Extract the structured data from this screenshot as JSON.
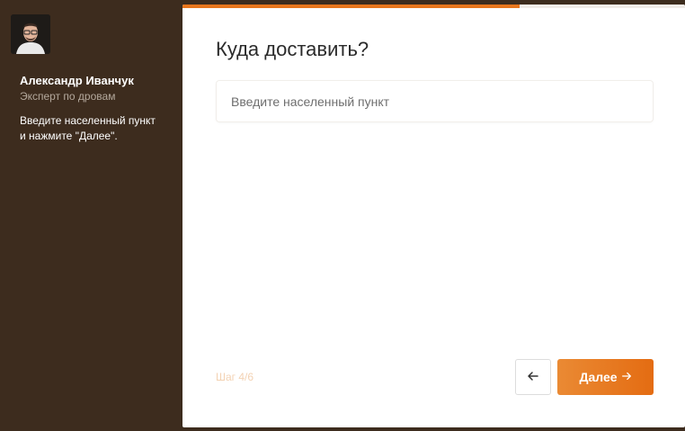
{
  "expert": {
    "name": "Александр Иванчук",
    "role": "Эксперт по дровам",
    "hint_line1": "Введите населенный пункт",
    "hint_line2": "и нажмите \"Далее\"."
  },
  "quiz": {
    "question": "Куда доставить?",
    "input_placeholder": "Введите населенный пункт",
    "input_value": "",
    "step_text": "Шаг 4/6",
    "progress_fraction": 0.67,
    "next_label": "Далее",
    "back_icon": "arrow-left-icon",
    "next_icon": "arrow-right-icon"
  },
  "colors": {
    "sidebar_bg": "#3d2c1e",
    "accent": "#e8761c"
  }
}
